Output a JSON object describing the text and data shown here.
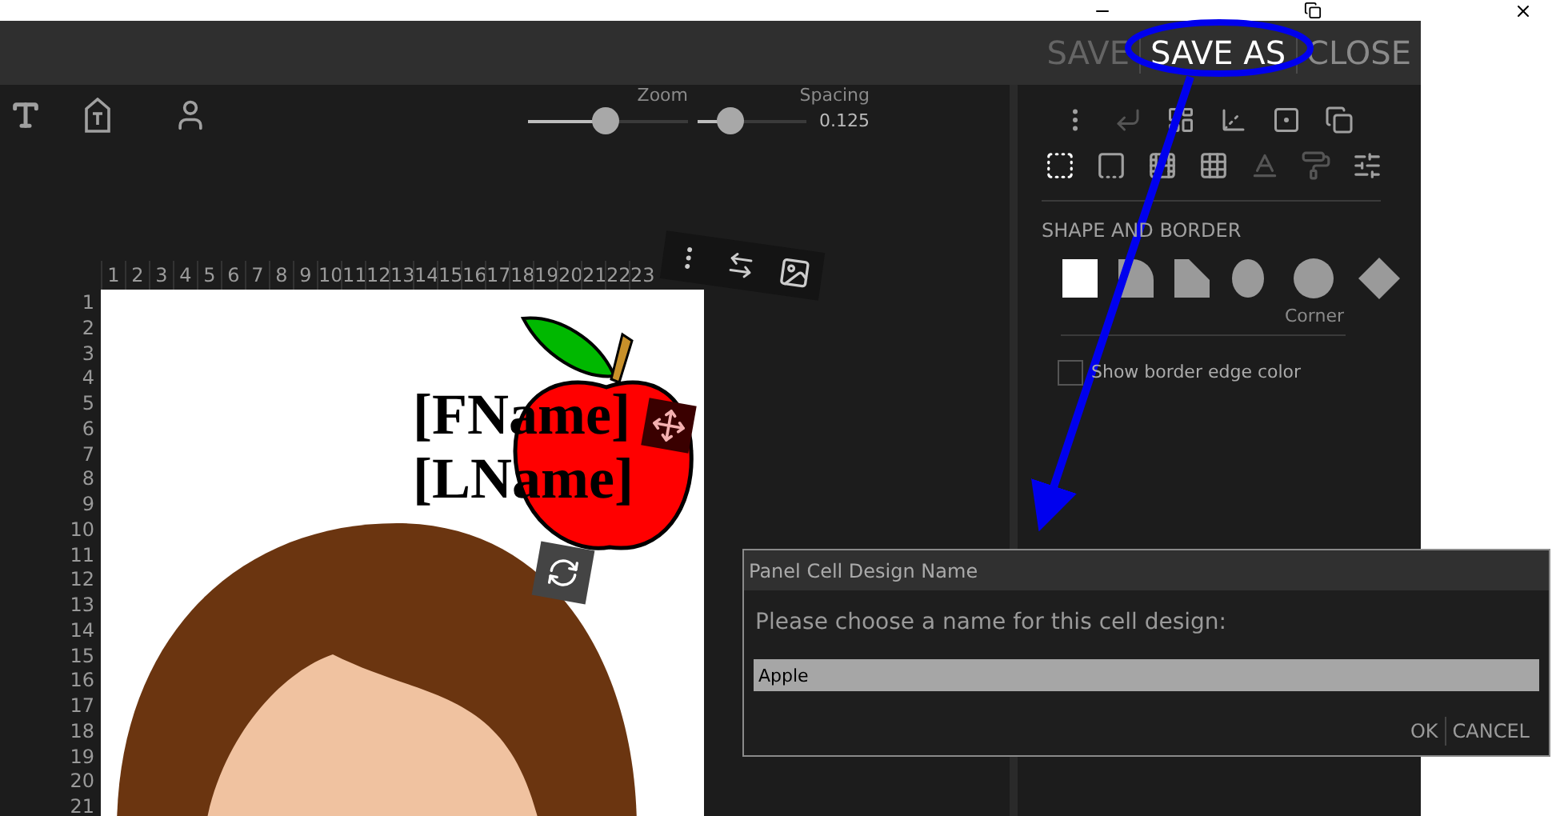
{
  "header": {
    "buttons": [
      {
        "label": "SAVE",
        "disabled": true,
        "highlighted": false
      },
      {
        "label": "SAVE AS",
        "disabled": false,
        "highlighted": true
      },
      {
        "label": "CLOSE",
        "disabled": false,
        "highlighted": false
      }
    ]
  },
  "sliders": [
    {
      "label": "Zoom",
      "level": 0.48
    },
    {
      "label": "Spacing",
      "level": 0.3,
      "reading": "0.125"
    }
  ],
  "ruler": {
    "columns": [
      "1",
      "2",
      "3",
      "4",
      "5",
      "6",
      "7",
      "8",
      "9",
      "10",
      "11",
      "12",
      "13",
      "14",
      "15",
      "16",
      "17",
      "18",
      "19",
      "20",
      "21",
      "22",
      "23"
    ],
    "rows": [
      "1",
      "2",
      "3",
      "4",
      "5",
      "6",
      "7",
      "8",
      "9",
      "10",
      "11",
      "12",
      "13",
      "14",
      "15",
      "16",
      "17",
      "18",
      "19",
      "20",
      "21"
    ]
  },
  "canvas": {
    "text_lines": [
      "[FName]",
      "[LName]"
    ]
  },
  "panel": {
    "section_title": "SHAPE AND BORDER",
    "shapes": [
      {
        "kind": "square",
        "selected": true
      },
      {
        "kind": "rounded",
        "selected": false
      },
      {
        "kind": "cut",
        "selected": false
      },
      {
        "kind": "oval",
        "selected": false
      },
      {
        "kind": "circle",
        "selected": false,
        "caption": "Corner"
      },
      {
        "kind": "diamond",
        "selected": false
      }
    ],
    "checkbox": {
      "label": "Show border edge color",
      "checked": false
    }
  },
  "dialog": {
    "title": "Panel Cell Design Name",
    "prompt": "Please choose a name for this cell design:",
    "value": "Apple",
    "buttons": [
      "OK",
      "CANCEL"
    ]
  }
}
